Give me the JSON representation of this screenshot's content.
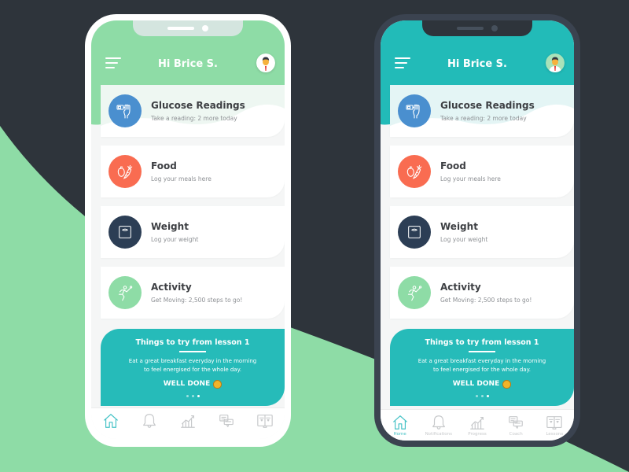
{
  "colors": {
    "background_dark": "#2e343b",
    "background_green": "#8edca6",
    "white_phone_header": "#8edca6",
    "dark_phone_header": "#22bbb8",
    "glucose_icon": "#4a8fcf",
    "food_icon": "#f96c51",
    "weight_icon": "#2c3e55",
    "activity_icon": "#8edca6",
    "lesson_card": "#26bbb9",
    "active_tab": "#45c2c6",
    "inactive_tab": "#c7c9cb"
  },
  "phones": [
    {
      "variant": "white",
      "header": {
        "greeting": "Hi Brice S.",
        "menu_icon": "hamburger-icon",
        "avatar_icon": "user-avatar-icon"
      },
      "cards": [
        {
          "title": "Glucose Readings",
          "subtitle": "Take a reading: 2 more today",
          "icon": "glucose-meter-icon"
        },
        {
          "title": "Food",
          "subtitle": "Log your meals here",
          "icon": "food-icon"
        },
        {
          "title": "Weight",
          "subtitle": "Log your weight",
          "icon": "scale-icon"
        },
        {
          "title": "Activity",
          "subtitle": "Get Moving: 2,500 steps to go!",
          "icon": "running-icon"
        }
      ],
      "lesson": {
        "title": "Things to try from lesson 1",
        "body_line1": "Eat a great breakfast everyday in the morning",
        "body_line2": "to feel energised for the whole day.",
        "cta": "WELL DONE",
        "cta_icon": "clapping-hands-icon",
        "pages": 3,
        "active_page": 3
      },
      "tabs": [
        {
          "label": "",
          "icon": "home-icon",
          "active": true
        },
        {
          "label": "",
          "icon": "bell-icon",
          "active": false
        },
        {
          "label": "",
          "icon": "progress-chart-icon",
          "active": false
        },
        {
          "label": "",
          "icon": "chat-icon",
          "active": false
        },
        {
          "label": "",
          "icon": "book-icon",
          "active": false
        }
      ]
    },
    {
      "variant": "dark",
      "header": {
        "greeting": "Hi Brice S.",
        "menu_icon": "hamburger-icon",
        "avatar_icon": "user-avatar-icon"
      },
      "cards": [
        {
          "title": "Glucose Readings",
          "subtitle": "Take a reading: 2 more today",
          "icon": "glucose-meter-icon"
        },
        {
          "title": "Food",
          "subtitle": "Log your meals here",
          "icon": "food-icon"
        },
        {
          "title": "Weight",
          "subtitle": "Log your weight",
          "icon": "scale-icon"
        },
        {
          "title": "Activity",
          "subtitle": "Get Moving: 2,500 steps to go!",
          "icon": "running-icon"
        }
      ],
      "lesson": {
        "title": "Things to try from lesson 1",
        "body_line1": "Eat a great breakfast everyday in the morning",
        "body_line2": "to feel energised for the whole day.",
        "cta": "WELL DONE",
        "cta_icon": "clapping-hands-icon",
        "pages": 3,
        "active_page": 3
      },
      "tabs": [
        {
          "label": "Home",
          "icon": "home-icon",
          "active": true
        },
        {
          "label": "Notifications",
          "icon": "bell-icon",
          "active": false
        },
        {
          "label": "Progress",
          "icon": "progress-chart-icon",
          "active": false
        },
        {
          "label": "Coach",
          "icon": "chat-icon",
          "active": false
        },
        {
          "label": "Lessons",
          "icon": "book-icon",
          "active": false
        }
      ]
    }
  ]
}
